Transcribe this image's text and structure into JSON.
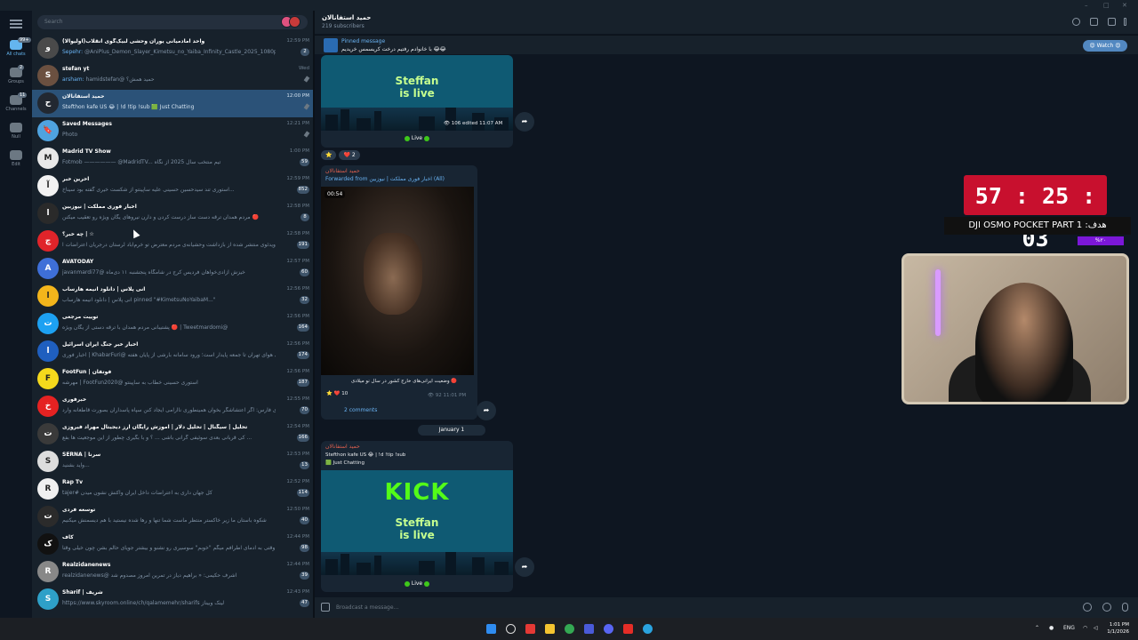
{
  "window": {
    "controls": [
      "–",
      "□",
      "✕"
    ]
  },
  "rail": {
    "folders": [
      {
        "label": "All chats",
        "count": "99+",
        "icon": "chat-bubble-icon"
      },
      {
        "label": "Groups",
        "count": "2",
        "icon": "group-icon"
      },
      {
        "label": "Channels",
        "count": "11",
        "icon": "channel-icon"
      },
      {
        "label": "Null",
        "icon": "mask-icon"
      },
      {
        "label": "Edit",
        "icon": "sliders-icon"
      }
    ]
  },
  "search": {
    "placeholder": "Search"
  },
  "chats": [
    {
      "name": "واحد امادمیانی یوران وحشی لبیک‌گوی انقلاب(اولیوالا)",
      "preview_sender": "Sepehr:",
      "preview": "@AniPlus_Demon_Slayer_Kimetsu_no_Yaiba_Infinity_Castle_2025_1080p.mkv",
      "time": "12:59 PM",
      "badge": "2",
      "avatar": "#4a4a4a",
      "initial": "و"
    },
    {
      "name": "stefan yt",
      "preview_sender": "arsham:",
      "preview": "hamidstefan@ حمید همش؟",
      "time": "Wed",
      "pinned": true,
      "avatar": "#6b5040",
      "initial": "S"
    },
    {
      "name": "حمید استفانالان",
      "preview": "Stefthon kafe US 😂 | !d !tip !sub 🟩 Just Chatting",
      "time": "12:00 PM",
      "pinned": true,
      "selected": true,
      "avatar": "#222831",
      "initial": "ح"
    },
    {
      "name": "Saved Messages",
      "preview": "Photo",
      "time": "12:21 PM",
      "pinned": true,
      "avatar": "#4fa3e0",
      "initial": "🔖"
    },
    {
      "name": "Madrid TV Show",
      "preview": "Fotmob —————— @MadridTV... تیم منتخب سال 2025 از نگاه",
      "time": "1:00 PM",
      "badge": "59",
      "avatar": "#e8e8e8",
      "initial": "M"
    },
    {
      "name": "آخرین خبر",
      "preview": "استوری تند سید‌حسین حسینی علیه ساپینتو از شکست خیری گفته بود سیناخ...",
      "time": "12:59 PM",
      "badge": "852",
      "avatar": "#f2f2f2",
      "initial": "آ"
    },
    {
      "name": "اخبار فوری مملکت | نیوزبین",
      "preview": "مردم همدان ترقه دست ساز درست کردن و دارن نیروهای یگان ویژه رو تعقیب میکنن 🔴",
      "time": "12:58 PM",
      "badge": "8",
      "avatar": "#2a2a2a",
      "initial": "ا"
    },
    {
      "name": "چه خبر؟ | ☆",
      "preview": "ویدئوی منتشر شده از بازداشت وحشیانه‌ی مردم معترض تو خرم‌آباد لرستان درجریان اعتراضات ا...",
      "time": "12:58 PM",
      "badge": "191",
      "avatar": "#e0242a",
      "initial": "چ"
    },
    {
      "name": "AVATODAY",
      "preview": "javanmardi77@ خیزش آزادی‌خواهان فردیس کرج در شامگاه پنجشنبه ۱۱ دی‌ماه",
      "time": "12:57 PM",
      "badge": "60",
      "avatar": "#3e6fd8",
      "initial": "A"
    },
    {
      "name": "انی پلاس | دانلود انیمه هارساب",
      "preview": "انی پلاس | دانلود انیمه هارساب pinned \"#KimetsuNoYaibaM...\"",
      "time": "12:56 PM",
      "badge": "32",
      "avatar": "#f3b51b",
      "initial": "ا"
    },
    {
      "name": "توییت مرجعی",
      "preview": "پشتیبانی مردم همدان با ترقه دستی از یگان ویژه 🔴 | Tweetmardomi@",
      "time": "12:56 PM",
      "badge": "164",
      "avatar": "#1da1f2",
      "initial": "ت"
    },
    {
      "name": "اخبار خبر جنگ ایران اسرائیل",
      "preview": "اخبار فوری | KhabarFuri@ آلودگی هوای تهران تا جمعه پایدار است؛ ورود سامانه بارشی از پایان هفته",
      "time": "12:56 PM",
      "badge": "174",
      "avatar": "#1f5fbf",
      "initial": "ا"
    },
    {
      "name": "FootFun | فوتفان",
      "preview": "مهرشه | FootFun2020@ استوری حسینی خطاب به ساپینتو",
      "time": "12:56 PM",
      "badge": "187",
      "avatar": "#f5d91c",
      "initial": "F"
    },
    {
      "name": "خبرفوری",
      "preview": "خبرگزاری فارس: اگر اعتشاشگر بخوان همینطوری ناآرامی ایجاد کنن سپاه پاسداران بصورت قاطعانه وارد...",
      "time": "12:55 PM",
      "badge": "70",
      "avatar": "#e52222",
      "initial": "خ"
    },
    {
      "name": "تحلیل | سیگنال | تحلیل دلار | آموزش رایگان ارز دیجیتال مهراد فیروزی",
      "preview": "کی قربانی بعدی سوئیفی گرانی باشی ... ؟ و با بگیری چطور از این موجعیت ها بفع ...",
      "time": "12:54 PM",
      "badge": "166",
      "avatar": "#3a3a3a",
      "initial": "ت"
    },
    {
      "name": "SERNA | سرنا",
      "preview": "واید بشنید...",
      "time": "12:53 PM",
      "badge": "13",
      "avatar": "#dddddd",
      "initial": "S"
    },
    {
      "name": "Rap Tv",
      "preview": "tajer# کل جهان داری به اعتراضات داخل ایران واکنش نشون میدن",
      "time": "12:52 PM",
      "badge": "114",
      "avatar": "#f0f0f0",
      "initial": "R"
    },
    {
      "name": "توسعه فردی",
      "preview": "شکوه باستان ما زیر خاکستر منتظر ماست  شما تنها و رها شده نیستید  با هم دیسمنش میکنیم",
      "time": "12:50 PM",
      "badge": "40",
      "avatar": "#2b2b2b",
      "initial": "ت"
    },
    {
      "name": "کاف",
      "preview": "کاش وقتی به آدمای اطرافم میگم \"خوبم\" سوسیری رو نشنو و بیشتر جویای حالم بشن چون خیلی وقتا ...",
      "time": "12:44 PM",
      "badge": "98",
      "avatar": "#111111",
      "initial": "ک"
    },
    {
      "name": "Realzidanenews",
      "preview": "realzidanenews@ اشرف حکیمی: « براهیم دیاز در تمرین امروز مصدوم شد",
      "time": "12:44 PM",
      "badge": "39",
      "avatar": "#888888",
      "initial": "R"
    },
    {
      "name": "Sharif | شریف",
      "preview": "https://www.skyroom.online/ch/qalamemehr/sharifs  لینک وبیناز",
      "time": "12:43 PM",
      "badge": "47",
      "avatar": "#2ea0c8",
      "initial": "S"
    }
  ],
  "channel": {
    "title": "حمید استفانالان",
    "subscribers": "219 subscribers"
  },
  "pinned": {
    "label": "Pinned message",
    "text": "با خانوادم رفتیم درخت کریسمس خریدیم 😂😂"
  },
  "watch": {
    "label": "😍 Watch 😍"
  },
  "messages": {
    "m1": {
      "kick_line1": "Steffan",
      "kick_line2": "is live",
      "views": "106",
      "edited": "edited 11:07 AM",
      "live": "Live",
      "reaction_star": "⭐",
      "reaction_heart": "❤️ 2"
    },
    "m2": {
      "sender": "حمید استفانالان",
      "forwarded": "Forwarded from",
      "source": "اخبار فوری مملکت | نیوزبین (All)",
      "duration": "00:54",
      "caption": "وضعیت ایرانی‌های خارج کشور در سال نو میلادی 🔴",
      "reaction": "⭐ ❤️ 10",
      "views": "92",
      "time": "11:01 PM",
      "comments": "2 comments"
    },
    "date": "January 1",
    "m3": {
      "sender": "حمید استفانالان",
      "title": "Stefthon kafe US 😂 | !d !tip !sub",
      "category": "🟩 Just Chatting",
      "kick": "KICK",
      "kick_line1": "Steffan",
      "kick_line2": "is live",
      "live": "Live"
    }
  },
  "composer": {
    "placeholder": "Broadcast a message..."
  },
  "overlay": {
    "timer": "57 : 25 : 03",
    "goal": "DJI OSMO POCKET PART 1 :هدف",
    "goal_bar": "%٢٠"
  },
  "taskbar": {
    "lang": "ENG",
    "time": "1:01 PM",
    "date": "1/1/2026"
  }
}
